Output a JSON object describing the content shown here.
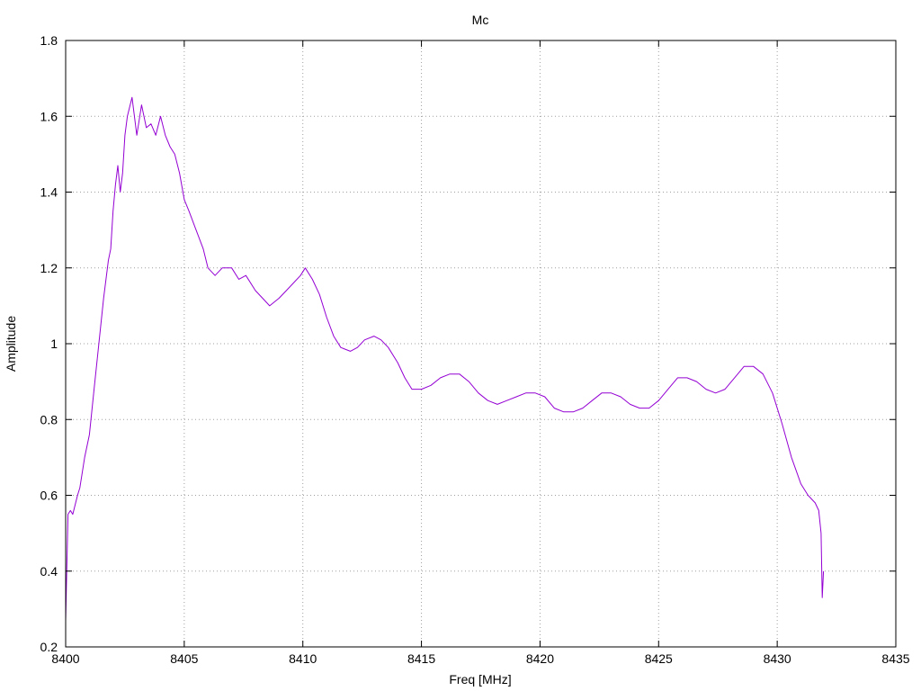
{
  "chart_data": {
    "type": "line",
    "title": "Mc",
    "xlabel": "Freq [MHz]",
    "ylabel": "Amplitude",
    "xlim": [
      8400,
      8435
    ],
    "ylim": [
      0.2,
      1.8
    ],
    "x_ticks": [
      8400,
      8405,
      8410,
      8415,
      8420,
      8425,
      8430,
      8435
    ],
    "y_ticks": [
      0.2,
      0.4,
      0.6,
      0.8,
      1,
      1.2,
      1.4,
      1.6,
      1.8
    ],
    "y_tick_labels": [
      "0.2",
      "0.4",
      "0.6",
      "0.8",
      "1",
      "1.2",
      "1.4",
      "1.6",
      "1.8"
    ],
    "grid": true,
    "legend": "none",
    "series": [
      {
        "color": "#9400d3",
        "x": [
          8400.0,
          8400.1,
          8400.2,
          8400.3,
          8400.5,
          8400.6,
          8400.8,
          8401.0,
          8401.2,
          8401.4,
          8401.6,
          8401.8,
          8401.9,
          8402.0,
          8402.1,
          8402.2,
          8402.3,
          8402.4,
          8402.5,
          8402.6,
          8402.8,
          8403.0,
          8403.2,
          8403.4,
          8403.6,
          8403.8,
          8404.0,
          8404.2,
          8404.4,
          8404.6,
          8404.8,
          8405.0,
          8405.2,
          8405.5,
          8405.8,
          8406.0,
          8406.3,
          8406.6,
          8407.0,
          8407.3,
          8407.6,
          8408.0,
          8408.3,
          8408.6,
          8409.0,
          8409.3,
          8409.6,
          8409.9,
          8410.1,
          8410.4,
          8410.7,
          8411.0,
          8411.3,
          8411.6,
          8412.0,
          8412.3,
          8412.6,
          8413.0,
          8413.3,
          8413.6,
          8414.0,
          8414.3,
          8414.6,
          8415.0,
          8415.4,
          8415.8,
          8416.2,
          8416.6,
          8417.0,
          8417.4,
          8417.8,
          8418.2,
          8418.6,
          8419.0,
          8419.4,
          8419.8,
          8420.2,
          8420.6,
          8421.0,
          8421.4,
          8421.8,
          8422.2,
          8422.6,
          8423.0,
          8423.4,
          8423.8,
          8424.2,
          8424.6,
          8425.0,
          8425.4,
          8425.8,
          8426.2,
          8426.6,
          8427.0,
          8427.4,
          8427.8,
          8428.2,
          8428.6,
          8429.0,
          8429.4,
          8429.8,
          8430.2,
          8430.6,
          8431.0,
          8431.3,
          8431.6,
          8431.75,
          8431.85,
          8431.9,
          8431.95
        ],
        "values": [
          0.27,
          0.55,
          0.56,
          0.55,
          0.6,
          0.62,
          0.7,
          0.76,
          0.88,
          1.0,
          1.12,
          1.22,
          1.25,
          1.35,
          1.42,
          1.47,
          1.4,
          1.45,
          1.55,
          1.6,
          1.65,
          1.55,
          1.63,
          1.57,
          1.58,
          1.55,
          1.6,
          1.55,
          1.52,
          1.5,
          1.45,
          1.38,
          1.35,
          1.3,
          1.25,
          1.2,
          1.18,
          1.2,
          1.2,
          1.17,
          1.18,
          1.14,
          1.12,
          1.1,
          1.12,
          1.14,
          1.16,
          1.18,
          1.2,
          1.17,
          1.13,
          1.07,
          1.02,
          0.99,
          0.98,
          0.99,
          1.01,
          1.02,
          1.01,
          0.99,
          0.95,
          0.91,
          0.88,
          0.88,
          0.89,
          0.91,
          0.92,
          0.92,
          0.9,
          0.87,
          0.85,
          0.84,
          0.85,
          0.86,
          0.87,
          0.87,
          0.86,
          0.83,
          0.82,
          0.82,
          0.83,
          0.85,
          0.87,
          0.87,
          0.86,
          0.84,
          0.83,
          0.83,
          0.85,
          0.88,
          0.91,
          0.91,
          0.9,
          0.88,
          0.87,
          0.88,
          0.91,
          0.94,
          0.94,
          0.92,
          0.87,
          0.79,
          0.7,
          0.63,
          0.6,
          0.58,
          0.56,
          0.5,
          0.33,
          0.4
        ]
      }
    ]
  }
}
